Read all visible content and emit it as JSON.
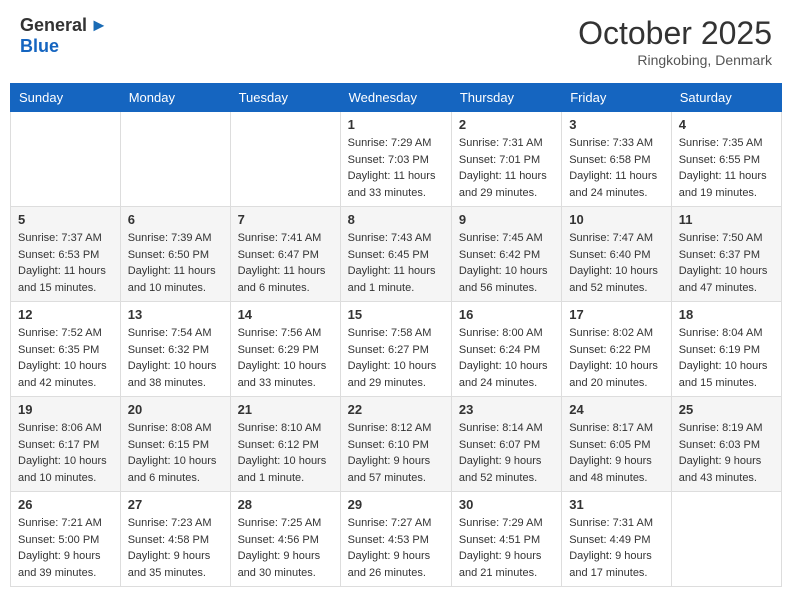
{
  "header": {
    "logo_general": "General",
    "logo_blue": "Blue",
    "month": "October 2025",
    "location": "Ringkobing, Denmark"
  },
  "days_of_week": [
    "Sunday",
    "Monday",
    "Tuesday",
    "Wednesday",
    "Thursday",
    "Friday",
    "Saturday"
  ],
  "weeks": [
    [
      {
        "day": "",
        "info": ""
      },
      {
        "day": "",
        "info": ""
      },
      {
        "day": "",
        "info": ""
      },
      {
        "day": "1",
        "info": "Sunrise: 7:29 AM\nSunset: 7:03 PM\nDaylight: 11 hours\nand 33 minutes."
      },
      {
        "day": "2",
        "info": "Sunrise: 7:31 AM\nSunset: 7:01 PM\nDaylight: 11 hours\nand 29 minutes."
      },
      {
        "day": "3",
        "info": "Sunrise: 7:33 AM\nSunset: 6:58 PM\nDaylight: 11 hours\nand 24 minutes."
      },
      {
        "day": "4",
        "info": "Sunrise: 7:35 AM\nSunset: 6:55 PM\nDaylight: 11 hours\nand 19 minutes."
      }
    ],
    [
      {
        "day": "5",
        "info": "Sunrise: 7:37 AM\nSunset: 6:53 PM\nDaylight: 11 hours\nand 15 minutes."
      },
      {
        "day": "6",
        "info": "Sunrise: 7:39 AM\nSunset: 6:50 PM\nDaylight: 11 hours\nand 10 minutes."
      },
      {
        "day": "7",
        "info": "Sunrise: 7:41 AM\nSunset: 6:47 PM\nDaylight: 11 hours\nand 6 minutes."
      },
      {
        "day": "8",
        "info": "Sunrise: 7:43 AM\nSunset: 6:45 PM\nDaylight: 11 hours\nand 1 minute."
      },
      {
        "day": "9",
        "info": "Sunrise: 7:45 AM\nSunset: 6:42 PM\nDaylight: 10 hours\nand 56 minutes."
      },
      {
        "day": "10",
        "info": "Sunrise: 7:47 AM\nSunset: 6:40 PM\nDaylight: 10 hours\nand 52 minutes."
      },
      {
        "day": "11",
        "info": "Sunrise: 7:50 AM\nSunset: 6:37 PM\nDaylight: 10 hours\nand 47 minutes."
      }
    ],
    [
      {
        "day": "12",
        "info": "Sunrise: 7:52 AM\nSunset: 6:35 PM\nDaylight: 10 hours\nand 42 minutes."
      },
      {
        "day": "13",
        "info": "Sunrise: 7:54 AM\nSunset: 6:32 PM\nDaylight: 10 hours\nand 38 minutes."
      },
      {
        "day": "14",
        "info": "Sunrise: 7:56 AM\nSunset: 6:29 PM\nDaylight: 10 hours\nand 33 minutes."
      },
      {
        "day": "15",
        "info": "Sunrise: 7:58 AM\nSunset: 6:27 PM\nDaylight: 10 hours\nand 29 minutes."
      },
      {
        "day": "16",
        "info": "Sunrise: 8:00 AM\nSunset: 6:24 PM\nDaylight: 10 hours\nand 24 minutes."
      },
      {
        "day": "17",
        "info": "Sunrise: 8:02 AM\nSunset: 6:22 PM\nDaylight: 10 hours\nand 20 minutes."
      },
      {
        "day": "18",
        "info": "Sunrise: 8:04 AM\nSunset: 6:19 PM\nDaylight: 10 hours\nand 15 minutes."
      }
    ],
    [
      {
        "day": "19",
        "info": "Sunrise: 8:06 AM\nSunset: 6:17 PM\nDaylight: 10 hours\nand 10 minutes."
      },
      {
        "day": "20",
        "info": "Sunrise: 8:08 AM\nSunset: 6:15 PM\nDaylight: 10 hours\nand 6 minutes."
      },
      {
        "day": "21",
        "info": "Sunrise: 8:10 AM\nSunset: 6:12 PM\nDaylight: 10 hours\nand 1 minute."
      },
      {
        "day": "22",
        "info": "Sunrise: 8:12 AM\nSunset: 6:10 PM\nDaylight: 9 hours\nand 57 minutes."
      },
      {
        "day": "23",
        "info": "Sunrise: 8:14 AM\nSunset: 6:07 PM\nDaylight: 9 hours\nand 52 minutes."
      },
      {
        "day": "24",
        "info": "Sunrise: 8:17 AM\nSunset: 6:05 PM\nDaylight: 9 hours\nand 48 minutes."
      },
      {
        "day": "25",
        "info": "Sunrise: 8:19 AM\nSunset: 6:03 PM\nDaylight: 9 hours\nand 43 minutes."
      }
    ],
    [
      {
        "day": "26",
        "info": "Sunrise: 7:21 AM\nSunset: 5:00 PM\nDaylight: 9 hours\nand 39 minutes."
      },
      {
        "day": "27",
        "info": "Sunrise: 7:23 AM\nSunset: 4:58 PM\nDaylight: 9 hours\nand 35 minutes."
      },
      {
        "day": "28",
        "info": "Sunrise: 7:25 AM\nSunset: 4:56 PM\nDaylight: 9 hours\nand 30 minutes."
      },
      {
        "day": "29",
        "info": "Sunrise: 7:27 AM\nSunset: 4:53 PM\nDaylight: 9 hours\nand 26 minutes."
      },
      {
        "day": "30",
        "info": "Sunrise: 7:29 AM\nSunset: 4:51 PM\nDaylight: 9 hours\nand 21 minutes."
      },
      {
        "day": "31",
        "info": "Sunrise: 7:31 AM\nSunset: 4:49 PM\nDaylight: 9 hours\nand 17 minutes."
      },
      {
        "day": "",
        "info": ""
      }
    ]
  ]
}
